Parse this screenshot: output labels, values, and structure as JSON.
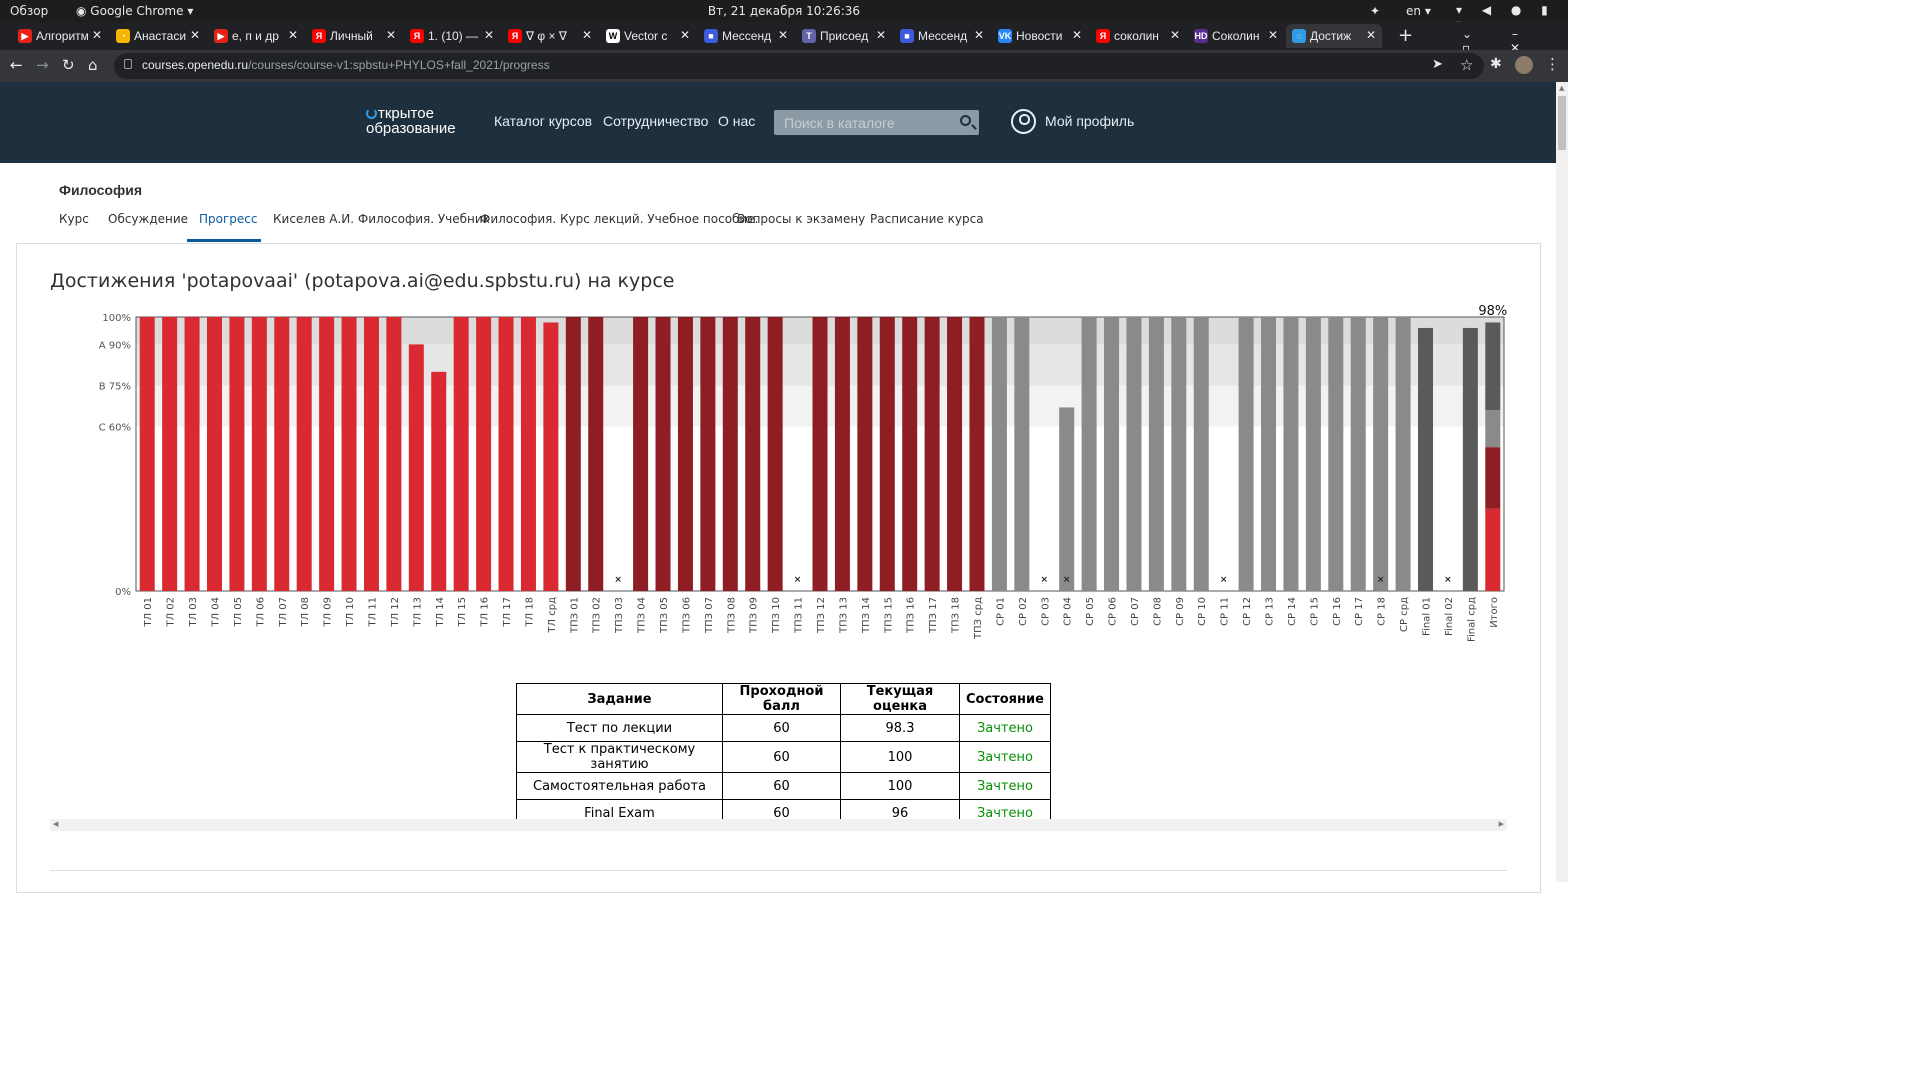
{
  "os": {
    "overview": "Обзор",
    "app": "Google Chrome",
    "clock": "Вт, 21 декабря  10:26:36",
    "lang": "en"
  },
  "tabs": [
    {
      "title": "Алгоритм",
      "color": "#e62117",
      "glyph": "▶"
    },
    {
      "title": "Анастасия",
      "color": "#f4b400",
      "glyph": "◔"
    },
    {
      "title": "е, п и др",
      "color": "#e62117",
      "glyph": "▶"
    },
    {
      "title": "Личный",
      "color": "#ff0000",
      "glyph": "Я"
    },
    {
      "title": "1. (10) —",
      "color": "#ff0000",
      "glyph": "Я"
    },
    {
      "title": "∇ φ × ∇",
      "color": "#ff0000",
      "glyph": "Я"
    },
    {
      "title": "Vector c",
      "color": "#ffffff",
      "glyph": "W"
    },
    {
      "title": "Мессенд",
      "color": "#3b5bdb",
      "glyph": "■"
    },
    {
      "title": "Присоед",
      "color": "#6264a7",
      "glyph": "T"
    },
    {
      "title": "Мессенд",
      "color": "#3b5bdb",
      "glyph": "■"
    },
    {
      "title": "Новости",
      "color": "#2787f5",
      "glyph": "VK"
    },
    {
      "title": "соколин",
      "color": "#ff0000",
      "glyph": "Я"
    },
    {
      "title": "Соколин",
      "color": "#5b2d91",
      "glyph": "HD"
    },
    {
      "title": "Достиж",
      "color": "#2f9be2",
      "glyph": "◌"
    }
  ],
  "address": {
    "domain": "courses.openedu.ru",
    "path": "/courses/course-v1:spbstu+PHYLOS+fall_2021/progress"
  },
  "site": {
    "logo_line1": "ткрытое",
    "logo_line2": "образование",
    "nav": [
      "Каталог курсов",
      "Сотрудничество",
      "О нас"
    ],
    "search_placeholder": "Поиск в каталоге",
    "profile": "Мой профиль"
  },
  "course": {
    "title": "Философия",
    "tabs": [
      "Курс",
      "Обсуждение",
      "Прогресс",
      "Киселев А.И. Философия. Учебник",
      "Философия. Курс лекций. Учебное пособие.",
      "Вопросы к экзамену",
      "Расписание курса"
    ]
  },
  "heading": "Достижения 'potapovaai' (potapova.ai@edu.spbstu.ru) на курсе",
  "chart_data": {
    "type": "bar",
    "ylim": [
      0,
      100
    ],
    "yticks": [
      {
        "label": "100%",
        "value": 100
      },
      {
        "label": "A 90%",
        "value": 90
      },
      {
        "label": "B 75%",
        "value": 75
      },
      {
        "label": "C 60%",
        "value": 60
      },
      {
        "label": "0%",
        "value": 0
      }
    ],
    "total_label": "98%",
    "colors": {
      "lecture": "#d82a30",
      "practice": "#8e1d24",
      "selfwork": "#8a8a8a",
      "final": "#5a5a5a"
    },
    "bars": [
      {
        "label": "ТЛ 01",
        "value": 100,
        "group": "lecture"
      },
      {
        "label": "ТЛ 02",
        "value": 100,
        "group": "lecture"
      },
      {
        "label": "ТЛ 03",
        "value": 100,
        "group": "lecture"
      },
      {
        "label": "ТЛ 04",
        "value": 100,
        "group": "lecture"
      },
      {
        "label": "ТЛ 05",
        "value": 100,
        "group": "lecture"
      },
      {
        "label": "ТЛ 06",
        "value": 100,
        "group": "lecture"
      },
      {
        "label": "ТЛ 07",
        "value": 100,
        "group": "lecture"
      },
      {
        "label": "ТЛ 08",
        "value": 100,
        "group": "lecture"
      },
      {
        "label": "ТЛ 09",
        "value": 100,
        "group": "lecture"
      },
      {
        "label": "ТЛ 10",
        "value": 100,
        "group": "lecture"
      },
      {
        "label": "ТЛ 11",
        "value": 100,
        "group": "lecture"
      },
      {
        "label": "ТЛ 12",
        "value": 100,
        "group": "lecture"
      },
      {
        "label": "ТЛ 13",
        "value": 90,
        "group": "lecture"
      },
      {
        "label": "ТЛ 14",
        "value": 80,
        "group": "lecture"
      },
      {
        "label": "ТЛ 15",
        "value": 100,
        "group": "lecture"
      },
      {
        "label": "ТЛ 16",
        "value": 100,
        "group": "lecture"
      },
      {
        "label": "ТЛ 17",
        "value": 100,
        "group": "lecture"
      },
      {
        "label": "ТЛ 18",
        "value": 100,
        "group": "lecture"
      },
      {
        "label": "ТЛ срд",
        "value": 98,
        "group": "lecture",
        "gap": true
      },
      {
        "label": "ТПЗ 01",
        "value": 100,
        "group": "practice",
        "gap": true
      },
      {
        "label": "ТПЗ 02",
        "value": 100,
        "group": "practice"
      },
      {
        "label": "ТПЗ 03",
        "value": 0,
        "group": "practice",
        "dropped": true
      },
      {
        "label": "ТПЗ 04",
        "value": 100,
        "group": "practice"
      },
      {
        "label": "ТПЗ 05",
        "value": 100,
        "group": "practice"
      },
      {
        "label": "ТПЗ 06",
        "value": 100,
        "group": "practice"
      },
      {
        "label": "ТПЗ 07",
        "value": 100,
        "group": "practice"
      },
      {
        "label": "ТПЗ 08",
        "value": 100,
        "group": "practice"
      },
      {
        "label": "ТПЗ 09",
        "value": 100,
        "group": "practice"
      },
      {
        "label": "ТПЗ 10",
        "value": 100,
        "group": "practice"
      },
      {
        "label": "ТПЗ 11",
        "value": 0,
        "group": "practice",
        "dropped": true
      },
      {
        "label": "ТПЗ 12",
        "value": 100,
        "group": "practice"
      },
      {
        "label": "ТПЗ 13",
        "value": 100,
        "group": "practice"
      },
      {
        "label": "ТПЗ 14",
        "value": 100,
        "group": "practice"
      },
      {
        "label": "ТПЗ 15",
        "value": 100,
        "group": "practice"
      },
      {
        "label": "ТПЗ 16",
        "value": 100,
        "group": "practice"
      },
      {
        "label": "ТПЗ 17",
        "value": 100,
        "group": "practice"
      },
      {
        "label": "ТПЗ 18",
        "value": 100,
        "group": "practice"
      },
      {
        "label": "ТПЗ срд",
        "value": 100,
        "group": "practice",
        "gap": true
      },
      {
        "label": "СР 01",
        "value": 100,
        "group": "selfwork",
        "gap": true
      },
      {
        "label": "СР 02",
        "value": 100,
        "group": "selfwork"
      },
      {
        "label": "СР 03",
        "value": 0,
        "group": "selfwork",
        "dropped": true
      },
      {
        "label": "СР 04",
        "value": 67,
        "group": "selfwork",
        "dropped": true
      },
      {
        "label": "СР 05",
        "value": 100,
        "group": "selfwork"
      },
      {
        "label": "СР 06",
        "value": 100,
        "group": "selfwork"
      },
      {
        "label": "СР 07",
        "value": 100,
        "group": "selfwork"
      },
      {
        "label": "СР 08",
        "value": 100,
        "group": "selfwork"
      },
      {
        "label": "СР 09",
        "value": 100,
        "group": "selfwork"
      },
      {
        "label": "СР 10",
        "value": 100,
        "group": "selfwork"
      },
      {
        "label": "СР 11",
        "value": 0,
        "group": "selfwork",
        "dropped": true
      },
      {
        "label": "СР 12",
        "value": 100,
        "group": "selfwork"
      },
      {
        "label": "СР 13",
        "value": 100,
        "group": "selfwork"
      },
      {
        "label": "СР 14",
        "value": 100,
        "group": "selfwork"
      },
      {
        "label": "СР 15",
        "value": 100,
        "group": "selfwork"
      },
      {
        "label": "СР 16",
        "value": 100,
        "group": "selfwork"
      },
      {
        "label": "СР 17",
        "value": 100,
        "group": "selfwork"
      },
      {
        "label": "СР 18",
        "value": 100,
        "group": "selfwork",
        "dropped": true
      },
      {
        "label": "СР срд",
        "value": 100,
        "group": "selfwork",
        "gap": true
      },
      {
        "label": "Final 01",
        "value": 96,
        "group": "final",
        "gap": true
      },
      {
        "label": "Final 02",
        "value": 0,
        "group": "final",
        "dropped": true
      },
      {
        "label": "Final срд",
        "value": 96,
        "group": "final",
        "gap": true
      },
      {
        "label": "Итого",
        "value": 98,
        "group": "total",
        "stack": [
          {
            "value": 30,
            "color": "#d82a30"
          },
          {
            "value": 22.5,
            "color": "#8e1d24"
          },
          {
            "value": 13.5,
            "color": "#8a8a8a"
          },
          {
            "value": 32,
            "color": "#5a5a5a"
          }
        ]
      }
    ]
  },
  "table": {
    "headers": [
      "Задание",
      "Проходной балл",
      "Текущая оценка",
      "Состояние"
    ],
    "rows": [
      [
        "Тест по лекции",
        "60",
        "98.3",
        "Зачтено"
      ],
      [
        "Тест к практическому занятию",
        "60",
        "100",
        "Зачтено"
      ],
      [
        "Самостоятельная работа",
        "60",
        "100",
        "Зачтено"
      ],
      [
        "Final Exam",
        "60",
        "96",
        "Зачтено"
      ]
    ]
  }
}
